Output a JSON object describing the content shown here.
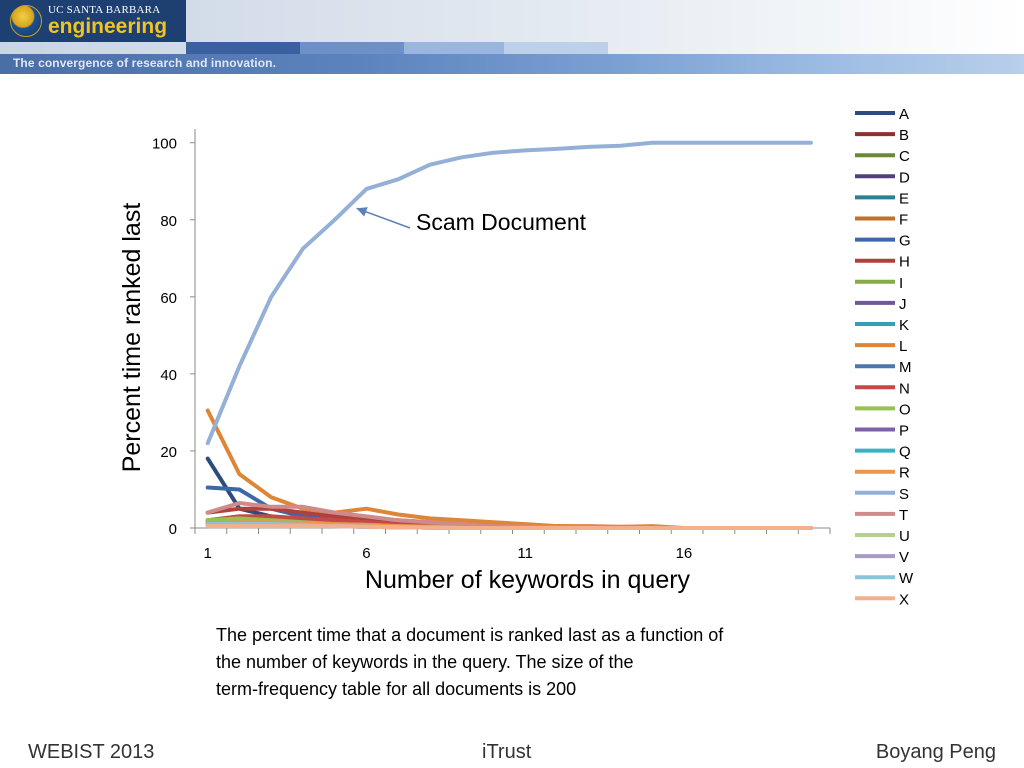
{
  "header": {
    "logo_top": "UC SANTA BARBARA",
    "logo_main": "engineering",
    "tagline": "The convergence of research and innovation."
  },
  "colors": {
    "banner_dark": "#1e3f72",
    "logo_yellow": "#f3c41e",
    "scam_line": "#94b0d6"
  },
  "chart_data": {
    "type": "line",
    "ylabel": "Percent time ranked last",
    "xlabel": "Number of keywords in query",
    "x": [
      1,
      2,
      3,
      4,
      5,
      6,
      7,
      8,
      9,
      10,
      11,
      12,
      13,
      14,
      15,
      16,
      17,
      18,
      19,
      20
    ],
    "xticks": [
      1,
      6,
      11,
      16
    ],
    "yticks": [
      0,
      20,
      40,
      60,
      80,
      100
    ],
    "xlim": [
      0.6,
      20.6
    ],
    "ylim": [
      0,
      102
    ],
    "grid": false,
    "legend_position": "right",
    "annotation": {
      "text": "Scam Document",
      "series": "S",
      "x": 5.5
    },
    "series": [
      {
        "name": "A",
        "color": "#2c4d7c",
        "values": [
          18,
          5,
          3,
          2,
          1.5,
          1,
          0.8,
          0.5,
          0.3,
          0.2,
          0.1,
          0,
          0,
          0,
          0,
          0,
          0,
          0,
          0,
          0
        ]
      },
      {
        "name": "B",
        "color": "#8a3330",
        "values": [
          1,
          1,
          1,
          1,
          0.8,
          0.5,
          0.5,
          0.3,
          0.2,
          0.1,
          0,
          0,
          0,
          0,
          0,
          0,
          0,
          0,
          0,
          0
        ]
      },
      {
        "name": "C",
        "color": "#6b8a32",
        "values": [
          2,
          3,
          3,
          2,
          1.5,
          1,
          0.5,
          0.3,
          0.2,
          0.1,
          0,
          0,
          0,
          0,
          0,
          0,
          0,
          0,
          0,
          0
        ]
      },
      {
        "name": "D",
        "color": "#53407a",
        "values": [
          1,
          1,
          1,
          0.8,
          0.5,
          0.5,
          0.3,
          0.2,
          0.1,
          0,
          0,
          0,
          0,
          0,
          0,
          0,
          0,
          0,
          0,
          0
        ]
      },
      {
        "name": "E",
        "color": "#2e8090",
        "values": [
          1.5,
          2,
          2,
          1.5,
          1,
          0.8,
          0.5,
          0.3,
          0.2,
          0.1,
          0,
          0,
          0,
          0,
          0,
          0,
          0,
          0,
          0,
          0
        ]
      },
      {
        "name": "F",
        "color": "#c0712c",
        "values": [
          1,
          1.5,
          1.5,
          1.2,
          1,
          0.8,
          0.5,
          0.3,
          0.2,
          0.1,
          0,
          0,
          0,
          0,
          0,
          0,
          0,
          0,
          0,
          0
        ]
      },
      {
        "name": "G",
        "color": "#3b68a8",
        "values": [
          10.5,
          10,
          5,
          3,
          2,
          1.5,
          1,
          0.5,
          0.3,
          0.2,
          0.1,
          0,
          0,
          0,
          0,
          0,
          0,
          0,
          0,
          0
        ]
      },
      {
        "name": "H",
        "color": "#b0403c",
        "values": [
          4,
          5,
          5,
          4,
          3,
          2.5,
          2,
          1.5,
          1,
          0.8,
          0.5,
          0.5,
          0.3,
          0.2,
          0.1,
          0,
          0,
          0,
          0,
          0
        ]
      },
      {
        "name": "I",
        "color": "#86aa44",
        "values": [
          2,
          3,
          2.5,
          2,
          1.5,
          1,
          0.5,
          0.3,
          0.2,
          0.1,
          0,
          0,
          0,
          0,
          0,
          0,
          0,
          0,
          0,
          0
        ]
      },
      {
        "name": "J",
        "color": "#6e5796",
        "values": [
          1,
          1,
          1,
          0.8,
          0.5,
          0.3,
          0.2,
          0.1,
          0,
          0,
          0,
          0,
          0,
          0,
          0,
          0,
          0,
          0,
          0,
          0
        ]
      },
      {
        "name": "K",
        "color": "#34a0b3",
        "values": [
          1,
          1.5,
          1.5,
          1,
          0.8,
          0.5,
          0.3,
          0.2,
          0.1,
          0,
          0,
          0,
          0,
          0,
          0,
          0,
          0,
          0,
          0,
          0
        ]
      },
      {
        "name": "L",
        "color": "#de8537",
        "values": [
          30.5,
          14,
          8,
          5,
          4,
          5,
          3.5,
          2.5,
          2,
          1.5,
          1,
          0.5,
          0.5,
          0.3,
          0.5,
          0,
          0,
          0,
          0,
          0
        ]
      },
      {
        "name": "M",
        "color": "#4a76b2",
        "values": [
          2,
          2,
          2,
          1.5,
          1,
          0.8,
          0.5,
          0.3,
          0.2,
          0.1,
          0,
          0,
          0,
          0,
          0,
          0,
          0,
          0,
          0,
          0
        ]
      },
      {
        "name": "N",
        "color": "#c6494a",
        "values": [
          2,
          3,
          3,
          2.5,
          2,
          1.5,
          1,
          0.5,
          0.3,
          0.2,
          0.1,
          0,
          0,
          0,
          0,
          0,
          0,
          0,
          0,
          0
        ]
      },
      {
        "name": "O",
        "color": "#97c151",
        "values": [
          2,
          2.5,
          2,
          1.5,
          1,
          0.8,
          0.5,
          0.3,
          0.2,
          0.1,
          0,
          0,
          0,
          0,
          0,
          0,
          0,
          0,
          0,
          0
        ]
      },
      {
        "name": "P",
        "color": "#7d62a8",
        "values": [
          1,
          1,
          1,
          0.8,
          0.5,
          0.3,
          0.2,
          0.1,
          0,
          0,
          0,
          0,
          0,
          0,
          0,
          0,
          0,
          0,
          0,
          0
        ]
      },
      {
        "name": "Q",
        "color": "#3bb1c6",
        "values": [
          1,
          1,
          1,
          0.8,
          0.5,
          0.3,
          0.2,
          0.1,
          0,
          0,
          0,
          0,
          0,
          0,
          0,
          0,
          0,
          0,
          0,
          0
        ]
      },
      {
        "name": "R",
        "color": "#f0944a",
        "values": [
          1,
          1.5,
          1.5,
          1.2,
          1,
          0.8,
          0.5,
          0.3,
          0.2,
          0.1,
          0,
          0,
          0,
          0,
          0,
          0,
          0,
          0,
          0,
          0
        ]
      },
      {
        "name": "S",
        "color": "#94b0d6",
        "values": [
          22,
          42,
          60,
          72.5,
          80,
          88,
          90.5,
          94.3,
          96.2,
          97.4,
          98,
          98.4,
          98.9,
          99.2,
          100,
          100,
          100,
          100,
          100,
          100
        ]
      },
      {
        "name": "T",
        "color": "#d08a8a",
        "values": [
          4,
          6.5,
          5.5,
          5.5,
          4,
          3,
          2,
          1.5,
          1,
          0.5,
          0.3,
          0.2,
          0.1,
          0,
          0,
          0,
          0,
          0,
          0,
          0
        ]
      },
      {
        "name": "U",
        "color": "#b7d08b",
        "values": [
          1,
          1,
          1,
          0.8,
          0.5,
          0.3,
          0.2,
          0.1,
          0,
          0,
          0,
          0,
          0,
          0,
          0,
          0,
          0,
          0,
          0,
          0
        ]
      },
      {
        "name": "V",
        "color": "#a99cc4",
        "values": [
          1,
          1,
          1,
          0.8,
          0.5,
          0.3,
          0.2,
          0.1,
          0,
          0,
          0,
          0,
          0,
          0,
          0,
          0,
          0,
          0,
          0,
          0
        ]
      },
      {
        "name": "W",
        "color": "#86c5dc",
        "values": [
          1,
          1,
          1,
          0.8,
          0.5,
          0.3,
          0.2,
          0.1,
          0,
          0,
          0,
          0,
          0,
          0,
          0,
          0,
          0,
          0,
          0,
          0
        ]
      },
      {
        "name": "X",
        "color": "#f4b08d",
        "values": [
          0.5,
          0.5,
          0.5,
          0.5,
          0.5,
          0.3,
          0.2,
          0.1,
          0,
          0,
          0,
          0,
          0,
          0,
          0,
          0,
          0,
          0,
          0,
          0
        ]
      }
    ]
  },
  "caption": {
    "line1": "The percent time that a document is ranked last as a function of",
    "line2": "the number of keywords in the query.  The size of the",
    "line3": "term-frequency table for all documents is 200"
  },
  "footer": {
    "left": "WEBIST 2013",
    "center": "iTrust",
    "right": "Boyang Peng"
  }
}
